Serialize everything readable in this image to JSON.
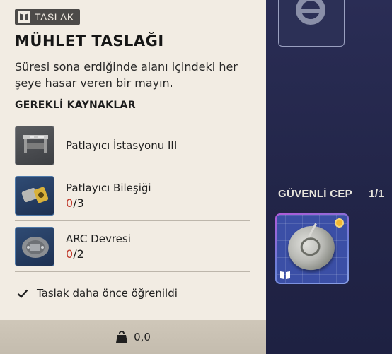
{
  "tooltip": {
    "tag_label": "TASLAK",
    "title": "MÜHLET TASLAĞI",
    "description": "Süresi sona erdiğinde alanı içindeki her şeye hasar veren bir mayın.",
    "resources_header": "GEREKLİ KAYNAKLAR",
    "resources": [
      {
        "name": "Patlayıcı İstasyonu III",
        "icon": "workbench-icon",
        "have": "",
        "need": ""
      },
      {
        "name": "Patlayıcı Bileşiği",
        "icon": "explosive-compound-icon",
        "have": "0",
        "need": "/3"
      },
      {
        "name": "ARC Devresi",
        "icon": "arc-circuit-icon",
        "have": "0",
        "need": "/2"
      }
    ],
    "learned_text": "Taslak daha önce öğrenildi",
    "weight": "0,0"
  },
  "safe_pocket": {
    "label": "GÜVENLİ CEP",
    "count": "1/1"
  },
  "colors": {
    "panel_bg": "#f2ece3",
    "missing_qty": "#c0392b",
    "rarity": "#f3b731"
  }
}
